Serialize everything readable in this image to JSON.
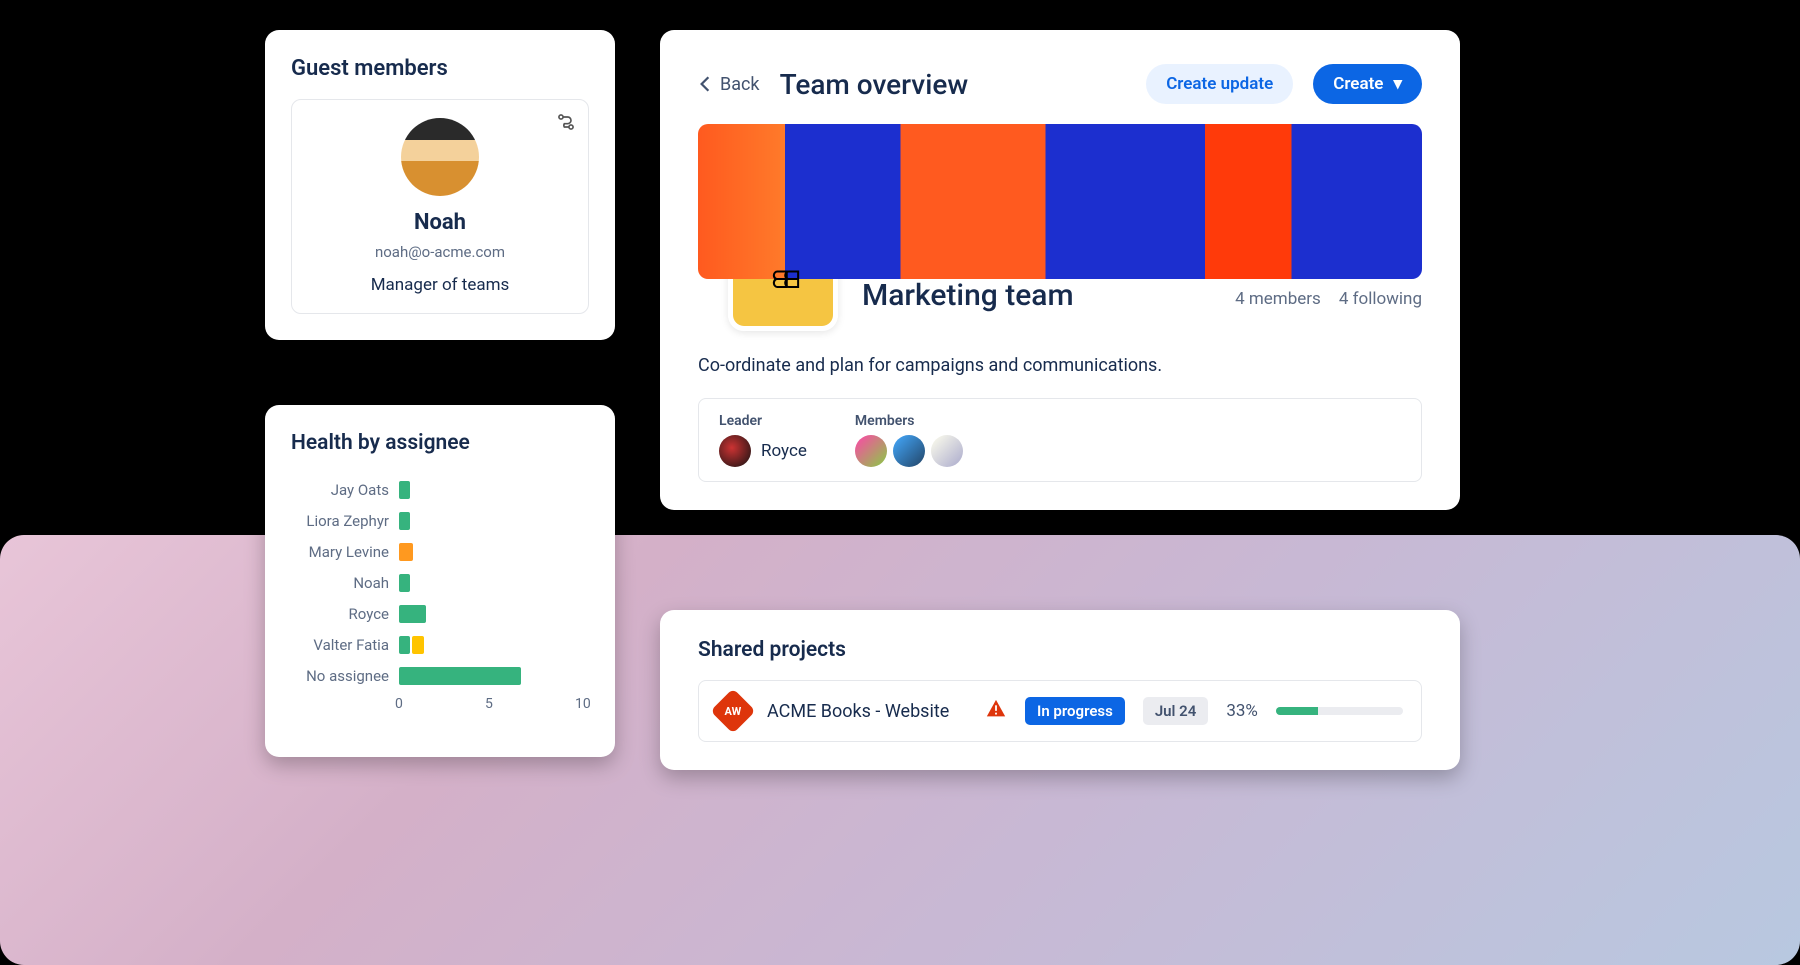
{
  "guest": {
    "section_title": "Guest members",
    "name": "Noah",
    "email": "noah@o-acme.com",
    "role": "Manager of teams"
  },
  "health": {
    "title": "Health by assignee"
  },
  "overview": {
    "back_label": "Back",
    "title": "Team overview",
    "create_update_label": "Create update",
    "create_label": "Create",
    "team_name": "Marketing team",
    "members_text": "4 members",
    "following_text": "4 following",
    "description": "Co-ordinate and plan for campaigns and communications.",
    "leader_label": "Leader",
    "leader_name": "Royce",
    "members_label": "Members"
  },
  "shared": {
    "title": "Shared projects",
    "project": {
      "icon_text": "AW",
      "name": "ACME Books - Website",
      "status": "In progress",
      "date": "Jul 24",
      "percent": "33%",
      "progress": 33
    }
  },
  "chart_data": {
    "type": "bar",
    "title": "Health by assignee",
    "xlabel": "",
    "ylabel": "",
    "xlim": [
      0,
      10
    ],
    "ticks": [
      0,
      5,
      10
    ],
    "categories": [
      "Jay Oats",
      "Liora Zephyr",
      "Mary Levine",
      "Noah",
      "Royce",
      "Valter Fatia",
      "No assignee"
    ],
    "series": [
      {
        "name": "green",
        "color": "#36b37e",
        "values": [
          0.6,
          0.6,
          0,
          0.6,
          1.5,
          0.6,
          6.8
        ]
      },
      {
        "name": "orange",
        "color": "#ff991f",
        "values": [
          0,
          0,
          0.8,
          0,
          0,
          0,
          0
        ]
      },
      {
        "name": "yellow",
        "color": "#ffc400",
        "values": [
          0,
          0,
          0,
          0,
          0,
          0.7,
          0
        ]
      }
    ]
  }
}
